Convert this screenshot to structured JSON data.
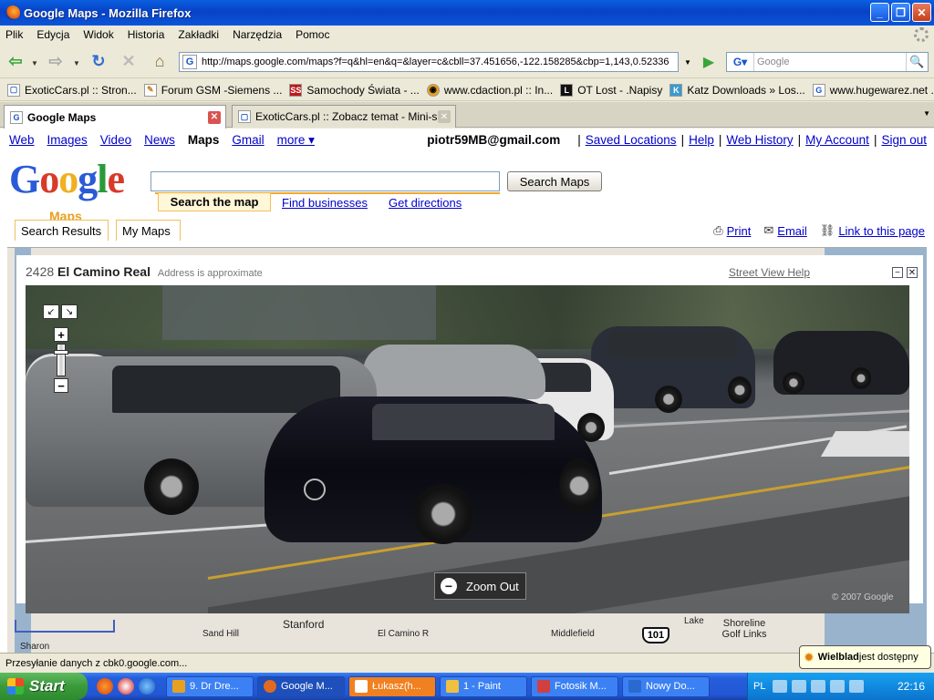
{
  "window": {
    "title": "Google Maps - Mozilla Firefox",
    "minimize": "_",
    "maximize": "❐",
    "close": "✕"
  },
  "menu": [
    "Plik",
    "Edycja",
    "Widok",
    "Historia",
    "Zakładki",
    "Narzędzia",
    "Pomoc"
  ],
  "nav": {
    "url": "http://maps.google.com/maps?f=q&hl=en&q=&layer=c&cbll=37.451656,-122.158285&cbp=1,143,0.52336",
    "search_placeholder": "Google"
  },
  "bookmarks": [
    {
      "label": "ExoticCars.pl :: Stron...",
      "icon": "ec"
    },
    {
      "label": "Forum GSM -Siemens ...",
      "icon": "f"
    },
    {
      "label": "Samochody Świata - ...",
      "icon": "SS"
    },
    {
      "label": "www.cdaction.pl :: In...",
      "icon": "cd"
    },
    {
      "label": "OT Lost - .Napisy",
      "icon": "L"
    },
    {
      "label": "Katz Downloads » Los...",
      "icon": "K"
    },
    {
      "label": "www.hugewarez.net ...",
      "icon": "G"
    }
  ],
  "tabs": [
    {
      "label": "Google Maps",
      "active": true
    },
    {
      "label": "ExoticCars.pl :: Zobacz temat - Mini-s...",
      "active": false
    }
  ],
  "gbar": {
    "links": [
      "Web",
      "Images",
      "Video",
      "News"
    ],
    "current": "Maps",
    "links2": [
      "Gmail"
    ],
    "more": "more ▾",
    "user": "piotr59MB@gmail.com",
    "right_links": [
      "Saved Locations",
      "Help",
      "Web History",
      "My Account",
      "Sign out"
    ]
  },
  "maps": {
    "logo_maps": "Maps",
    "search_button": "Search Maps",
    "tab_active": "Search the map",
    "tab_find": "Find businesses",
    "tab_directions": "Get directions",
    "panel_tabs": [
      "Search Results",
      "My Maps"
    ],
    "print": "Print",
    "email": "Email",
    "link": "Link to this page"
  },
  "streetview": {
    "number": "2428",
    "street": "El Camino Real",
    "approx": "Address is approximate",
    "help": "Street View Help",
    "zoom_out": "Zoom Out",
    "copyright": "© 2007 Google"
  },
  "map_labels": [
    "Stanford",
    "Sand Hill",
    "El Camino R",
    "Middlefield",
    "Lake",
    "Shoreline Golf Links",
    "Sharon"
  ],
  "highway": "101",
  "status": {
    "text": "Przesyłanie danych z cbk0.google.com...",
    "notify_bold": "Wielblad",
    "notify_rest": " jest dostępny"
  },
  "taskbar": {
    "start": "Start",
    "tasks": [
      {
        "label": "9. Dr Dre..."
      },
      {
        "label": "Google M..."
      },
      {
        "label": "Łukasz(h..."
      },
      {
        "label": "1 - Paint"
      },
      {
        "label": "Fotosik M..."
      },
      {
        "label": "Nowy Do..."
      }
    ],
    "lang": "PL",
    "clock": "22:16"
  }
}
